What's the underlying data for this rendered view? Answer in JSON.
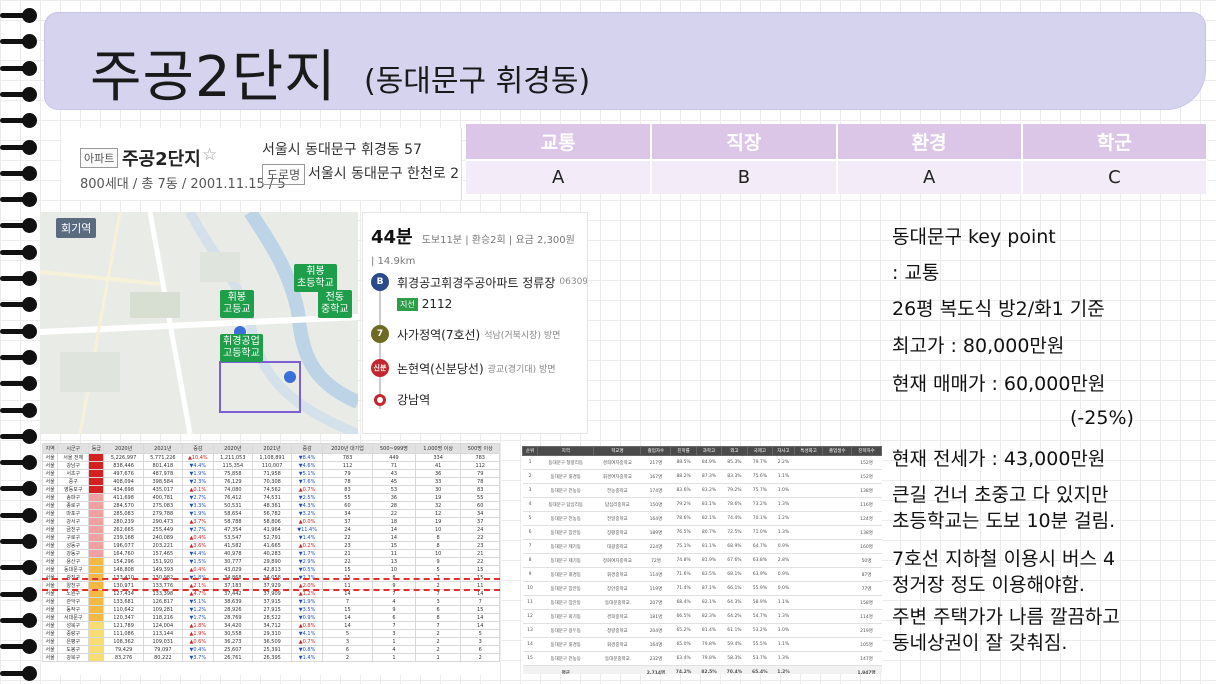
{
  "title": {
    "main": "주공2단지",
    "sub": "(동대문구 휘경동)"
  },
  "apartment": {
    "type_badge": "아파트",
    "name": "주공2단지",
    "star": "☆",
    "meta": "800세대 / 총 7동 / 2001.11.15 / 5",
    "address": "서울시 동대문구 휘경동 57",
    "road_badge": "도로명",
    "road_address": "서울시 동대문구 한천로 2"
  },
  "grades": {
    "headers": [
      "교통",
      "직장",
      "환경",
      "학군"
    ],
    "values": [
      "A",
      "B",
      "A",
      "C"
    ]
  },
  "map": {
    "station_label": "회기역",
    "places": [
      "휘봉\n초등학교",
      "휘봉\n고등교",
      "전동\n중학교",
      "휘경공업\n고등학교"
    ]
  },
  "route": {
    "time": "44분",
    "detail": "도보11분 | 환승2회 | 요금 2,300원 | 14.9km",
    "steps": [
      {
        "icon": "bus-icon",
        "label": "휘경공고휘경주공아파트 정류장",
        "small": "06309",
        "color": "#2b4a8c",
        "icon_text": "B"
      },
      {
        "icon": "subway-line7-icon",
        "label": "사가정역(7호선)",
        "small": "석남(거북시장) 방면",
        "color": "#6d6b23",
        "icon_text": "7"
      },
      {
        "icon": "subway-sinbundang-icon",
        "label": "논현역(신분당선)",
        "small": "광교(경기대) 방면",
        "color": "#c1272d",
        "icon_text": "신분"
      },
      {
        "icon": "destination-icon",
        "label": "강남역",
        "small": "",
        "color": "#c1272d",
        "icon_text": ""
      }
    ],
    "bus_tag": "지선",
    "bus_number": "2112"
  },
  "notes": {
    "lines": [
      "동대문구 key point",
      " : 교통",
      "26평 복도식 방2/화1 기준",
      "최고가 : 80,000만원",
      "현재 매매가 : 60,000만원",
      "(-25%)",
      "현재 전세가 : 43,000만원",
      "큰길 건너 초중고 다 있지만",
      "초등학교는 도보 10분 걸림.",
      "7호선 지하철 이용시 버스 4",
      "정거장 정도 이용해야함.",
      "주변 주택가가 나름 깔끔하고",
      "동네상권이 잘 갖춰짐."
    ]
  },
  "data_table": {
    "headers": [
      "지역",
      "시군구",
      "등급",
      "2020년",
      "2021년",
      "증감",
      "2020년",
      "2021년",
      "증감",
      "2020년 대기업",
      "500~999명",
      "1,000명 이상",
      "500명 이상"
    ],
    "rows": [
      [
        "서울",
        "서울 전체",
        "",
        "5,226,997",
        "5,771,226",
        "▲10.4%",
        "1,211,053",
        "1,108,891",
        "▼8.4%",
        "783",
        "449",
        "334",
        "783"
      ],
      [
        "서울",
        "강남구",
        "",
        "838,446",
        "801,418",
        "▼4.4%",
        "115,354",
        "110,007",
        "▼4.6%",
        "112",
        "71",
        "41",
        "112"
      ],
      [
        "서울",
        "서초구",
        "",
        "497,676",
        "487,978",
        "▼1.9%",
        "75,858",
        "71,958",
        "▼5.1%",
        "79",
        "43",
        "36",
        "79"
      ],
      [
        "서울",
        "중구",
        "",
        "408,094",
        "398,584",
        "▼2.3%",
        "76,129",
        "70,308",
        "▼7.6%",
        "78",
        "45",
        "33",
        "78"
      ],
      [
        "서울",
        "영등포구",
        "",
        "434,698",
        "435,017",
        "▲0.1%",
        "74,080",
        "74,562",
        "▲0.7%",
        "83",
        "53",
        "30",
        "83"
      ],
      [
        "서울",
        "송파구",
        "",
        "411,698",
        "400,781",
        "▼2.7%",
        "76,412",
        "74,531",
        "▼2.5%",
        "55",
        "36",
        "19",
        "55"
      ],
      [
        "서울",
        "종로구",
        "",
        "284,570",
        "275,083",
        "▼3.3%",
        "50,531",
        "48,361",
        "▼4.3%",
        "60",
        "28",
        "32",
        "60"
      ],
      [
        "서울",
        "마포구",
        "",
        "285,083",
        "279,788",
        "▼1.9%",
        "58,654",
        "56,782",
        "▼3.2%",
        "34",
        "22",
        "12",
        "34"
      ],
      [
        "서울",
        "강서구",
        "",
        "280,239",
        "290,473",
        "▲3.7%",
        "58,788",
        "58,806",
        "▲0.0%",
        "37",
        "18",
        "19",
        "37"
      ],
      [
        "서울",
        "금천구",
        "",
        "262,665",
        "255,449",
        "▼2.7%",
        "47,354",
        "41,964",
        "▼11.4%",
        "24",
        "14",
        "10",
        "24"
      ],
      [
        "서울",
        "구로구",
        "",
        "239,168",
        "240,089",
        "▲0.4%",
        "53,547",
        "52,791",
        "▼1.4%",
        "22",
        "14",
        "8",
        "22"
      ],
      [
        "서울",
        "성동구",
        "",
        "196,077",
        "203,221",
        "▲3.6%",
        "41,582",
        "41,665",
        "▲0.2%",
        "23",
        "15",
        "8",
        "23"
      ],
      [
        "서울",
        "강동구",
        "",
        "164,760",
        "157,465",
        "▼4.4%",
        "40,978",
        "40,283",
        "▼1.7%",
        "21",
        "11",
        "10",
        "21"
      ],
      [
        "서울",
        "용산구",
        "",
        "154,296",
        "151,920",
        "▼1.5%",
        "30,777",
        "29,890",
        "▼2.9%",
        "22",
        "13",
        "9",
        "22"
      ],
      [
        "서울",
        "동대문구",
        "",
        "148,808",
        "149,393",
        "▲0.4%",
        "43,029",
        "42,813",
        "▼0.5%",
        "15",
        "10",
        "5",
        "15"
      ],
      [
        "서울",
        "광진구",
        "",
        "133,410",
        "130,982",
        "▼1.8%",
        "34,868",
        "34,058",
        "▼2.3%",
        "15",
        "8",
        "7",
        "15"
      ],
      [
        "서울",
        "양천구",
        "",
        "130,971",
        "133,776",
        "▲2.1%",
        "37,183",
        "37,929",
        "▲2.0%",
        "11",
        "9",
        "2",
        "11"
      ],
      [
        "서울",
        "노원구",
        "",
        "127,434",
        "133,398",
        "▲4.7%",
        "37,442",
        "37,909",
        "▲1.2%",
        "14",
        "7",
        "7",
        "14"
      ],
      [
        "서울",
        "관악구",
        "",
        "133,681",
        "126,817",
        "▼5.1%",
        "38,639",
        "37,915",
        "▼1.9%",
        "7",
        "4",
        "3",
        "7"
      ],
      [
        "서울",
        "동작구",
        "",
        "110,642",
        "109,281",
        "▼1.2%",
        "28,926",
        "27,915",
        "▼3.5%",
        "15",
        "9",
        "6",
        "15"
      ],
      [
        "서울",
        "서대문구",
        "",
        "120,347",
        "118,216",
        "▼1.7%",
        "28,769",
        "28,522",
        "▼0.9%",
        "14",
        "6",
        "8",
        "14"
      ],
      [
        "서울",
        "성북구",
        "",
        "121,789",
        "124,004",
        "▲1.8%",
        "34,420",
        "34,712",
        "▲0.8%",
        "14",
        "7",
        "7",
        "14"
      ],
      [
        "서울",
        "중랑구",
        "",
        "111,086",
        "113,144",
        "▲1.9%",
        "30,558",
        "29,310",
        "▼4.1%",
        "5",
        "3",
        "2",
        "5"
      ],
      [
        "서울",
        "은평구",
        "",
        "108,362",
        "109,031",
        "▲0.6%",
        "36,273",
        "36,509",
        "▲0.7%",
        "3",
        "1",
        "2",
        "3"
      ],
      [
        "서울",
        "도봉구",
        "",
        "79,429",
        "79,097",
        "▼0.4%",
        "25,607",
        "25,391",
        "▼0.8%",
        "6",
        "4",
        "2",
        "6"
      ],
      [
        "서울",
        "강북구",
        "",
        "83,276",
        "80,222",
        "▼3.7%",
        "26,761",
        "26,395",
        "▼1.4%",
        "2",
        "1",
        "1",
        "2"
      ]
    ]
  },
  "rank_table": {
    "headers": [
      "순위",
      "지역",
      "학교명",
      "졸업자수",
      "진학률",
      "과학고",
      "외고",
      "국제고",
      "자사고",
      "특성화고",
      "졸업생수",
      "진학자수"
    ],
    "rows": [
      [
        "1",
        "동대문구 청량리동",
        "경희여자중학교",
        "217명",
        "88.5%",
        "84.9%",
        "85.3%",
        "79.7%",
        "2.2%",
        "",
        "",
        "152명"
      ],
      [
        "2",
        "동대문구 휘경동",
        "휘경여자중학교",
        "167명",
        "88.2%",
        "87.3%",
        "83.3%",
        "75.6%",
        "1.1%",
        "",
        "",
        "152명"
      ],
      [
        "3",
        "동대문구 전농동",
        "전농중학교",
        "174명",
        "83.6%",
        "83.2%",
        "79.2%",
        "75.7%",
        "1.0%",
        "",
        "",
        "138명"
      ],
      [
        "4",
        "동대문구 답십리동",
        "답십리중학교",
        "150명",
        "79.2%",
        "83.1%",
        "78.6%",
        "73.2%",
        "1.3%",
        "",
        "",
        "116명"
      ],
      [
        "5",
        "동대문구 전농동",
        "전일중학교",
        "164명",
        "78.6%",
        "82.1%",
        "74.4%",
        "70.1%",
        "1.2%",
        "",
        "",
        "124명"
      ],
      [
        "6",
        "동대문구 장안동",
        "장평중학교",
        "189명",
        "76.5%",
        "80.7%",
        "72.5%",
        "71.0%",
        "1.3%",
        "",
        "",
        "138명"
      ],
      [
        "7",
        "동대문구 제기동",
        "대광중학교",
        "224명",
        "75.1%",
        "81.1%",
        "68.9%",
        "64.7%",
        "0.9%",
        "",
        "",
        "160명"
      ],
      [
        "8",
        "동대문구 제기동",
        "정화여자중학교",
        "72명",
        "74.8%",
        "81.9%",
        "67.6%",
        "63.8%",
        "2.8%",
        "",
        "",
        "50명"
      ],
      [
        "9",
        "동대문구 휘경동",
        "휘경중학교",
        "114명",
        "71.6%",
        "83.5%",
        "68.1%",
        "63.9%",
        "0.9%",
        "",
        "",
        "87명"
      ],
      [
        "10",
        "동대문구 장안동",
        "장안중학교",
        "119명",
        "71.4%",
        "87.1%",
        "66.1%",
        "55.9%",
        "0.0%",
        "",
        "",
        "77명"
      ],
      [
        "11",
        "동대문구 장안동",
        "동대문중학교",
        "207명",
        "68.4%",
        "82.1%",
        "64.3%",
        "58.9%",
        "1.1%",
        "",
        "",
        "158명"
      ],
      [
        "12",
        "동대문구 회기동",
        "경희중학교",
        "181명",
        "66.5%",
        "82.3%",
        "64.2%",
        "54.7%",
        "1.3%",
        "",
        "",
        "114명"
      ],
      [
        "13",
        "동대문구 용두동",
        "청량중학교",
        "204명",
        "65.2%",
        "81.4%",
        "61.1%",
        "53.2%",
        "1.0%",
        "",
        "",
        "219명"
      ],
      [
        "14",
        "동대문구 휘경동",
        "휘경중학교",
        "164명",
        "65.0%",
        "79.8%",
        "59.4%",
        "55.5%",
        "1.1%",
        "",
        "",
        "105명"
      ],
      [
        "15",
        "동대문구 전농동",
        "동대문중학교",
        "232명",
        "63.4%",
        "79.8%",
        "58.3%",
        "53.7%",
        "1.3%",
        "",
        "",
        "147명"
      ]
    ],
    "total": [
      "",
      "평균",
      "",
      "2,714명",
      "74.2%",
      "82.5%",
      "70.4%",
      "65.4%",
      "1.2%",
      "",
      "",
      "1,947명"
    ]
  },
  "colors": {
    "banner": "#d6d3ef",
    "grade_header": "#dcc6e8",
    "grade_cell": "#f3ebf8",
    "map_label": "#1e9e4a",
    "grade_red": "#d42020",
    "grade_pink": "#f0a0a0",
    "grade_orange": "#f5b840",
    "grade_yellow": "#f7dc6f"
  }
}
